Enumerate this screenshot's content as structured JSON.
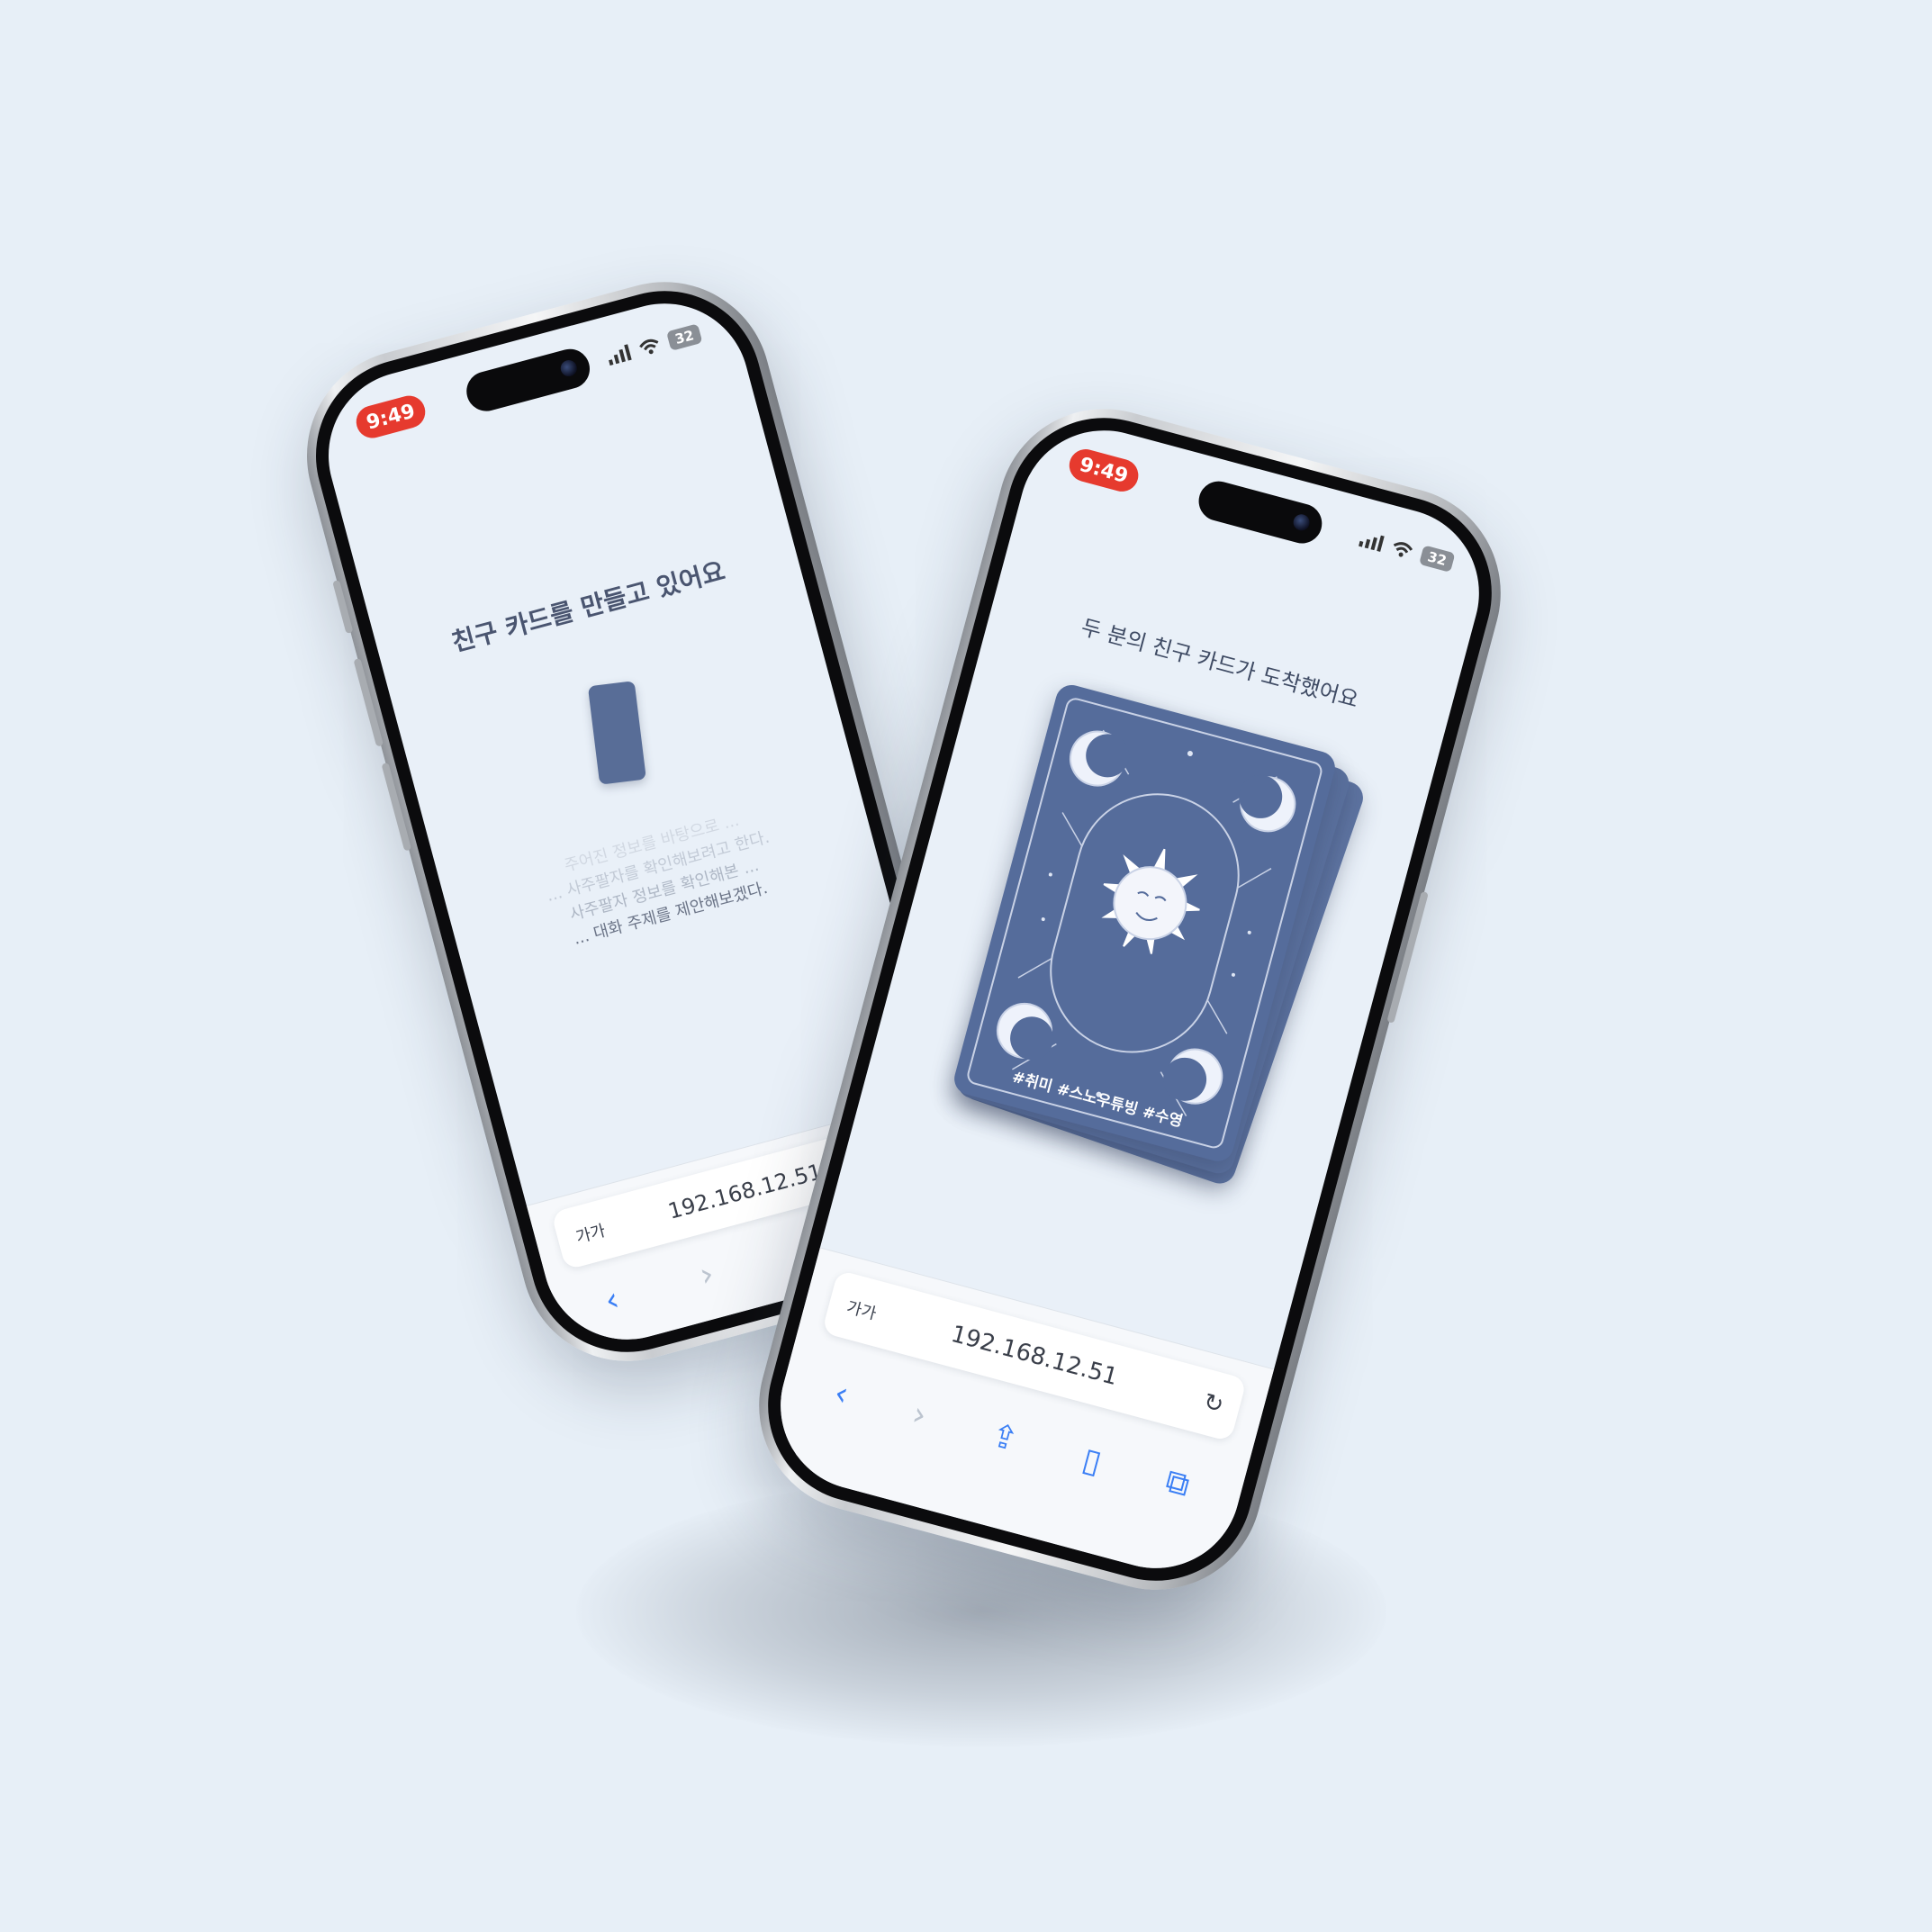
{
  "status": {
    "time": "9:49",
    "battery": "32"
  },
  "left_phone": {
    "heading": "친구 카드를 만들고 있어요",
    "messages": [
      "주어진 정보를 바탕으로 ...",
      "... 사주팔자를 확인해보려고 한다.",
      "사주팔자 정보를 확인해본 ...",
      "... 대화 주제를 제안해보겠다."
    ],
    "url": "192.168.12.51",
    "text_size_label": "가가"
  },
  "right_phone": {
    "heading": "두 분의 친구 카드가 도착했어요",
    "card_tags": "#취미 #스노우튜빙 #수영",
    "url": "192.168.12.51",
    "text_size_label": "가가"
  },
  "toolbar_icons": [
    "back-icon",
    "forward-icon",
    "share-icon",
    "bookmarks-icon",
    "tabs-icon",
    "reload-icon"
  ],
  "colors": {
    "accent": "#3b7ff5",
    "card": "#556c9b",
    "time_badge": "#e63a2e",
    "background": "#e7eff7"
  }
}
